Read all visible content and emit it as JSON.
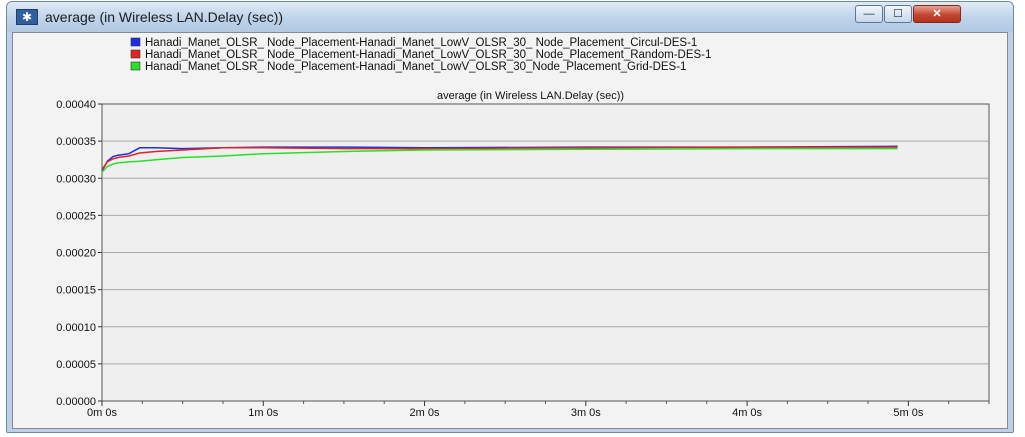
{
  "window": {
    "title": "average (in Wireless LAN.Delay (sec))",
    "controls": {
      "minimize": "—",
      "maximize": "☐",
      "close": "✕"
    },
    "icon": "chart-window-icon"
  },
  "chart_data": {
    "type": "line",
    "title": "average (in Wireless LAN.Delay (sec))",
    "xlabel": "",
    "ylabel": "",
    "grid": true,
    "legend_position": "top",
    "xlim": [
      0,
      330
    ],
    "ylim": [
      0.0,
      0.0004
    ],
    "x_ticks": [
      {
        "value": 0,
        "label": "0m 0s"
      },
      {
        "value": 60,
        "label": "1m 0s"
      },
      {
        "value": 120,
        "label": "2m 0s"
      },
      {
        "value": 180,
        "label": "3m 0s"
      },
      {
        "value": 240,
        "label": "4m 0s"
      },
      {
        "value": 300,
        "label": "5m 0s"
      }
    ],
    "y_ticks": [
      {
        "value": 0.0,
        "label": "0.00000"
      },
      {
        "value": 5e-05,
        "label": "0.00005"
      },
      {
        "value": 0.0001,
        "label": "0.00010"
      },
      {
        "value": 0.00015,
        "label": "0.00015"
      },
      {
        "value": 0.0002,
        "label": "0.00020"
      },
      {
        "value": 0.00025,
        "label": "0.00025"
      },
      {
        "value": 0.0003,
        "label": "0.00030"
      },
      {
        "value": 0.00035,
        "label": "0.00035"
      },
      {
        "value": 0.0004,
        "label": "0.00040"
      }
    ],
    "series": [
      {
        "name": "Hanadi_Manet_OLSR_ Node_Placement-Hanadi_Manet_LowV_OLSR_30_ Node_Placement_Circul-DES-1",
        "color": "#1f2fe0",
        "x": [
          0,
          2,
          4,
          6,
          10,
          14,
          20,
          30,
          45,
          60,
          90,
          120,
          180,
          240,
          296
        ],
        "y": [
          0.00031,
          0.000323,
          0.000329,
          0.000331,
          0.000333,
          0.000341,
          0.000341,
          0.00034,
          0.000341,
          0.000342,
          0.000342,
          0.000341,
          0.000342,
          0.000342,
          0.000343
        ]
      },
      {
        "name": "Hanadi_Manet_OLSR_ Node_Placement-Hanadi_Manet_LowV_OLSR_30_ Node_Placement_Random-DES-1",
        "color": "#e02424",
        "x": [
          0,
          2,
          4,
          6,
          10,
          14,
          20,
          30,
          45,
          60,
          90,
          120,
          180,
          240,
          296
        ],
        "y": [
          0.000312,
          0.000322,
          0.000326,
          0.000328,
          0.00033,
          0.000334,
          0.000336,
          0.000338,
          0.000341,
          0.000341,
          0.00034,
          0.00034,
          0.000341,
          0.000342,
          0.000342
        ]
      },
      {
        "name": "Hanadi_Manet_OLSR_ Node_Placement-Hanadi_Manet_LowV_OLSR_30_Node_Placement_Grid-DES-1",
        "color": "#28e028",
        "x": [
          0,
          2,
          4,
          6,
          10,
          14,
          20,
          30,
          45,
          60,
          90,
          120,
          180,
          240,
          296
        ],
        "y": [
          0.000308,
          0.000316,
          0.000319,
          0.000321,
          0.000322,
          0.000323,
          0.000325,
          0.000328,
          0.00033,
          0.000333,
          0.000336,
          0.000338,
          0.000339,
          0.00034,
          0.00034
        ]
      }
    ]
  }
}
